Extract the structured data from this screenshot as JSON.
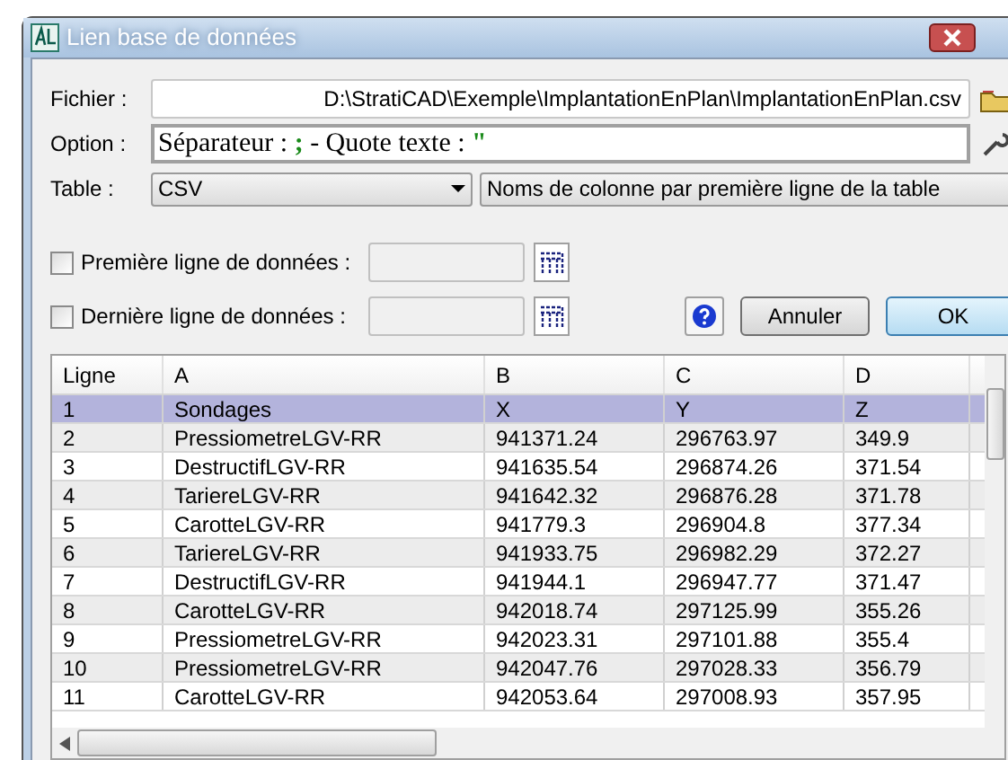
{
  "window": {
    "title": "Lien base de données"
  },
  "file": {
    "label": "Fichier :",
    "value": "D:\\StratiCAD\\Exemple\\ImplantationEnPlan\\ImplantationEnPlan.csv"
  },
  "option": {
    "label": "Option :",
    "segments": [
      {
        "text": "Séparateur : ",
        "kind": "plain"
      },
      {
        "text": ";",
        "kind": "symbol"
      },
      {
        "text": " - Quote texte : ",
        "kind": "plain"
      },
      {
        "text": "\"",
        "kind": "symbol"
      }
    ]
  },
  "table_select": {
    "label": "Table :",
    "value": "CSV",
    "header_mode": "Noms de colonne par première ligne de la table"
  },
  "range_rows": [
    {
      "label": "Première ligne de données :",
      "checked": false
    },
    {
      "label": "Dernière ligne de données :",
      "checked": false
    }
  ],
  "buttons": [
    {
      "label": "Annuler",
      "kind": "normal"
    },
    {
      "label": "OK",
      "kind": "default"
    }
  ],
  "grid": {
    "columns": [
      "Ligne",
      "A",
      "B",
      "C",
      "D"
    ],
    "rows": [
      {
        "cells": [
          "1",
          "Sondages",
          "X",
          "Y",
          "Z"
        ],
        "selected": true
      },
      {
        "cells": [
          "2",
          "PressiometreLGV-RR",
          "941371.24",
          "296763.97",
          "349.9"
        ],
        "selected": false
      },
      {
        "cells": [
          "3",
          "DestructifLGV-RR",
          "941635.54",
          "296874.26",
          "371.54"
        ],
        "selected": false
      },
      {
        "cells": [
          "4",
          "TariereLGV-RR",
          "941642.32",
          "296876.28",
          "371.78"
        ],
        "selected": false
      },
      {
        "cells": [
          "5",
          "CarotteLGV-RR",
          "941779.3",
          "296904.8",
          "377.34"
        ],
        "selected": false
      },
      {
        "cells": [
          "6",
          "TariereLGV-RR",
          "941933.75",
          "296982.29",
          "372.27"
        ],
        "selected": false
      },
      {
        "cells": [
          "7",
          "DestructifLGV-RR",
          "941944.1",
          "296947.77",
          "371.47"
        ],
        "selected": false
      },
      {
        "cells": [
          "8",
          "CarotteLGV-RR",
          "942018.74",
          "297125.99",
          "355.26"
        ],
        "selected": false
      },
      {
        "cells": [
          "9",
          "PressiometreLGV-RR",
          "942023.31",
          "297101.88",
          "355.4"
        ],
        "selected": false
      },
      {
        "cells": [
          "10",
          "PressiometreLGV-RR",
          "942047.76",
          "297028.33",
          "356.79"
        ],
        "selected": false
      },
      {
        "cells": [
          "11",
          "CarotteLGV-RR",
          "942053.64",
          "297008.93",
          "357.95"
        ],
        "selected": false
      }
    ]
  }
}
